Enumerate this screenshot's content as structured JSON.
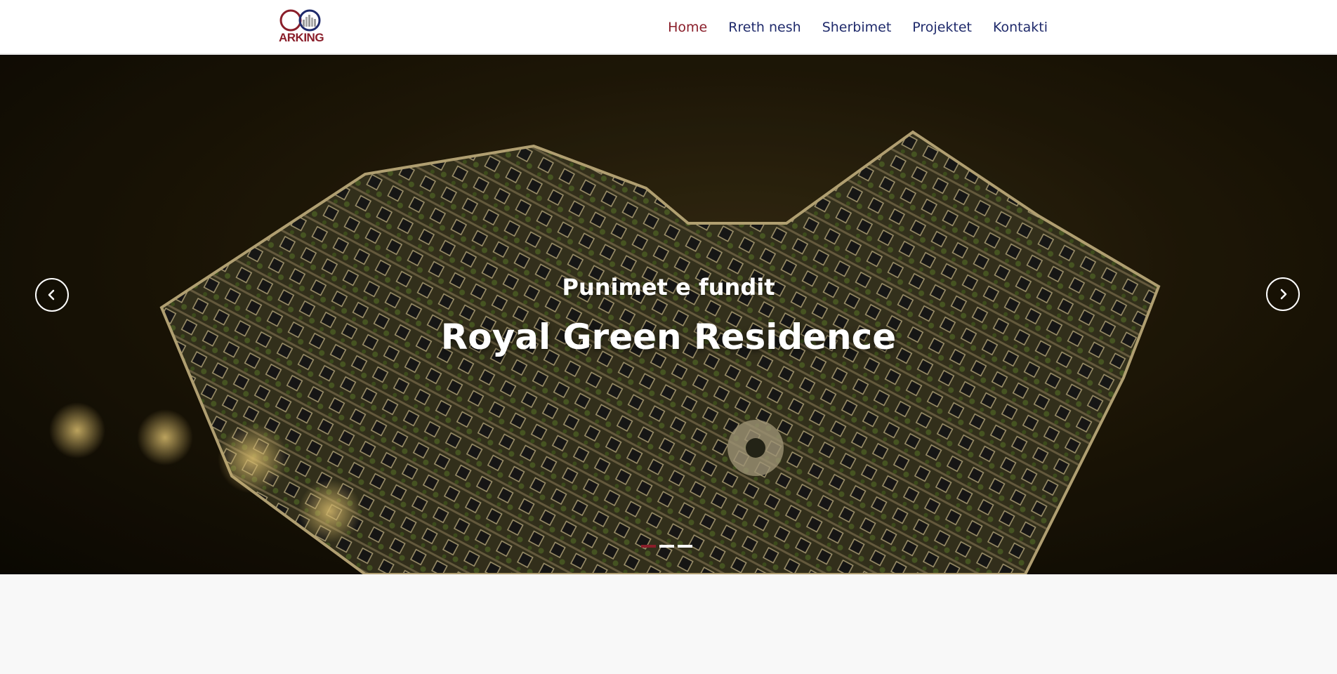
{
  "brand": {
    "logo_text": "ARKING",
    "colors": {
      "primary": "#8a1e2a",
      "nav": "#1f2a6b"
    }
  },
  "nav": {
    "items": [
      {
        "label": "Home",
        "active": true
      },
      {
        "label": "Rreth nesh",
        "active": false
      },
      {
        "label": "Sherbimet",
        "active": false
      },
      {
        "label": "Projektet",
        "active": false
      },
      {
        "label": "Kontakti",
        "active": false
      }
    ]
  },
  "hero": {
    "subtitle": "Punimet e fundit",
    "title": "Royal Green Residence",
    "prev_icon": "chevron-left-icon",
    "next_icon": "chevron-right-icon",
    "slides_count": 3,
    "active_slide": 1
  }
}
